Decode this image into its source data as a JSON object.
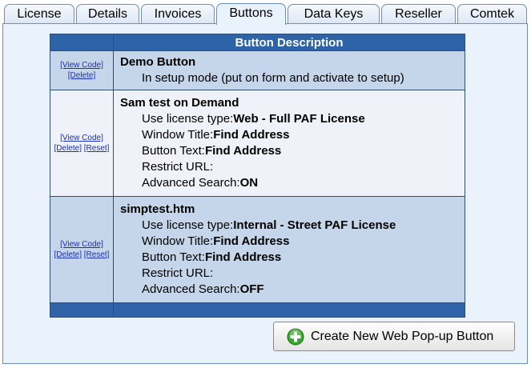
{
  "tabs": [
    {
      "label": "License"
    },
    {
      "label": "Details"
    },
    {
      "label": "Invoices"
    },
    {
      "label": "Buttons"
    },
    {
      "label": "Data Keys"
    },
    {
      "label": "Reseller"
    },
    {
      "label": "Comtek"
    }
  ],
  "active_tab": "Buttons",
  "table": {
    "header": "Button Description",
    "view_code_label": "[View Code]",
    "delete_label": "[Delete]",
    "reset_label": "[Reset]",
    "rows": [
      {
        "name": "Demo Button",
        "note": "In setup mode (put on form and activate to setup)"
      },
      {
        "name": "Sam test on Demand",
        "license_label": "Use license type:",
        "license_value": "Web - Full PAF License",
        "window_label": "Window Title:",
        "window_value": "Find Address",
        "button_text_label": "Button Text:",
        "button_text_value": "Find Address",
        "restrict_label": "Restrict URL:",
        "restrict_value": "",
        "advanced_label": "Advanced Search:",
        "advanced_value": "ON"
      },
      {
        "name": "simptest.htm",
        "license_label": "Use license type:",
        "license_value": "Internal - Street PAF License",
        "window_label": "Window Title:",
        "window_value": "Find Address",
        "button_text_label": "Button Text:",
        "button_text_value": "Find Address",
        "restrict_label": "Restrict URL:",
        "restrict_value": "",
        "advanced_label": "Advanced Search:",
        "advanced_value": "OFF"
      }
    ]
  },
  "create_button": {
    "label": "Create New Web Pop-up Button",
    "icon": "plus-circle-icon"
  },
  "colors": {
    "header_blue": "#2e64a7",
    "row_a": "#c5d6ea",
    "row_b": "#eff2f9",
    "panel": "#eaf2fb",
    "plus_green": "#3aa62c"
  }
}
